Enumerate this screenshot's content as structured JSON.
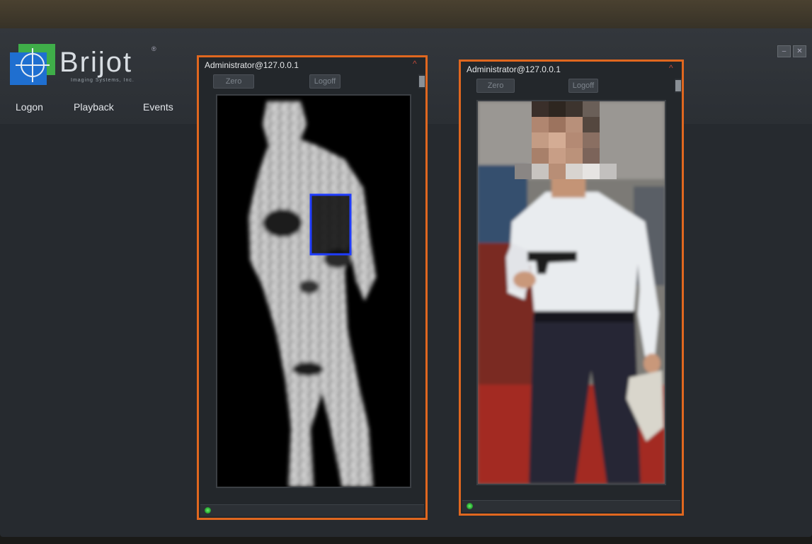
{
  "app": {
    "brand": "Brijot",
    "brand_sub": "Imaging Systems, Inc.",
    "reg": "®"
  },
  "menu": {
    "logon": "Logon",
    "playback": "Playback",
    "events": "Events"
  },
  "panels": [
    {
      "title": "Administrator@127.0.0.1",
      "zero_label": "Zero",
      "logoff_label": "Logoff",
      "view": "millimeter-wave scan"
    },
    {
      "title": "Administrator@127.0.0.1",
      "zero_label": "Zero",
      "logoff_label": "Logoff",
      "view": "video camera"
    }
  ],
  "colors": {
    "accent": "#e0671f",
    "detect_box": "#1f3cff",
    "status_led": "#3ad13a"
  }
}
